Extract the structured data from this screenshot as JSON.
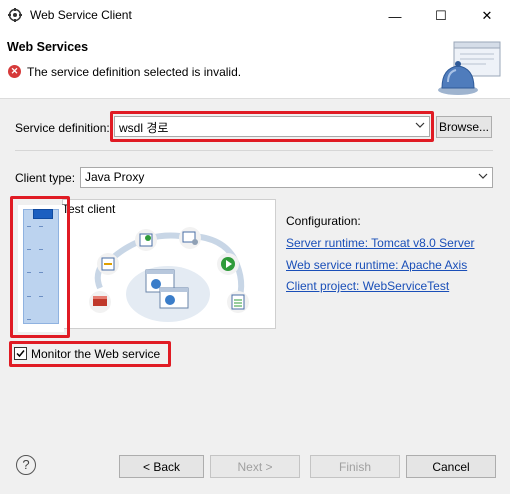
{
  "window": {
    "title": "Web Service Client",
    "minimize_glyph": "—",
    "maximize_glyph": "☐",
    "close_glyph": "✕"
  },
  "header": {
    "title": "Web Services",
    "error_message": "The service definition selected is invalid.",
    "error_icon": "error-icon"
  },
  "form": {
    "service_definition_label": "Service definition:",
    "service_definition_value": "wsdl 경로",
    "browse_label": "Browse...",
    "client_type_label": "Client type:",
    "client_type_value": "Java Proxy"
  },
  "slider": {
    "level_fraction": 0.0,
    "level_name": "Test client"
  },
  "test_panel": {
    "caption": "Test client"
  },
  "configuration": {
    "heading": "Configuration:",
    "server_runtime": "Server runtime: Tomcat v8.0 Server",
    "web_service_runtime": "Web service runtime: Apache Axis",
    "client_project": "Client project: WebServiceTest"
  },
  "monitor": {
    "label": "Monitor the Web service",
    "checked": true
  },
  "footer": {
    "help_glyph": "?",
    "back_label": "< Back",
    "next_label": "Next >",
    "finish_label": "Finish",
    "cancel_label": "Cancel"
  },
  "colors": {
    "highlight": "#e01b24",
    "link": "#1a4fb8",
    "slider_thumb": "#1c5fc0"
  }
}
